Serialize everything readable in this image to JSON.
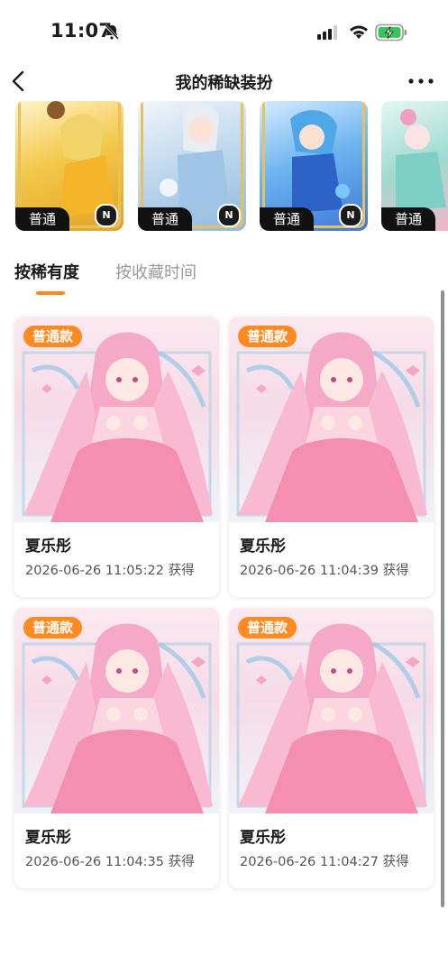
{
  "status_bar": {
    "time": "11:07"
  },
  "nav": {
    "title": "我的稀缺装扮"
  },
  "carousel": {
    "items": [
      {
        "tag": "普通",
        "badge": "N"
      },
      {
        "tag": "普通",
        "badge": "N"
      },
      {
        "tag": "普通",
        "badge": "N"
      },
      {
        "tag": "普通"
      }
    ]
  },
  "tabs": [
    {
      "label": "按稀有度"
    },
    {
      "label": "按收藏时间"
    }
  ],
  "cards": [
    {
      "badge": "普通款",
      "name": "夏乐彤",
      "time": "2026-06-26 11:05:22 获得"
    },
    {
      "badge": "普通款",
      "name": "夏乐彤",
      "time": "2026-06-26 11:04:39 获得"
    },
    {
      "badge": "普通款",
      "name": "夏乐彤",
      "time": "2026-06-26 11:04:35 获得"
    },
    {
      "badge": "普通款",
      "name": "夏乐彤",
      "time": "2026-06-26 11:04:27 获得"
    }
  ],
  "colors": {
    "accent": "#ff8a1f",
    "tag_bg": "#111111"
  }
}
